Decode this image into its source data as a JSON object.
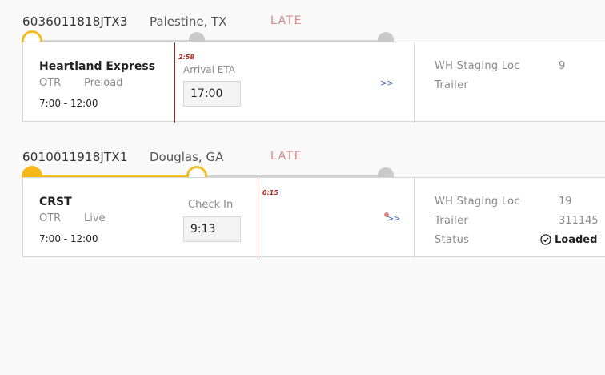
{
  "shipments": [
    {
      "id": "6036011818JTX3",
      "location": "Palestine, TX",
      "status": "LATE",
      "carrier": "Heartland Express",
      "mode": "OTR",
      "load_type": "Preload",
      "window": "7:00 - 12:00",
      "late_marker": "2:58",
      "field_label": "Arrival ETA",
      "field_value": "17:00",
      "more": ">>",
      "wh_staging_label": "WH Staging Loc",
      "wh_staging_value": "9",
      "trailer_label": "Trailer",
      "trailer_value": ""
    },
    {
      "id": "6010011918JTX1",
      "location": "Douglas, GA",
      "status": "LATE",
      "carrier": "CRST",
      "mode": "OTR",
      "load_type": "Live",
      "window": "7:00 - 12:00",
      "late_marker": "0:15",
      "field_label": "Check In",
      "field_value": "9:13",
      "more": ">>",
      "wh_staging_label": "WH Staging Loc",
      "wh_staging_value": "19",
      "trailer_label": "Trailer",
      "trailer_value": "311145",
      "status_label": "Status",
      "status_value": "Loaded"
    }
  ],
  "colors": {
    "progress": "#f3bd1f",
    "late": "#d98a8a",
    "marker": "#b3261e",
    "link": "#3b6cc4"
  },
  "icons": [
    "check-circle-icon",
    "expand-arrows-icon"
  ]
}
